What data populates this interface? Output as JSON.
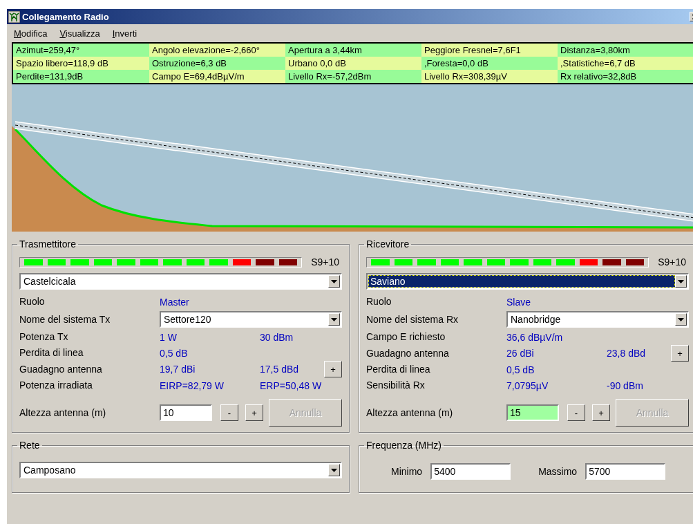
{
  "window": {
    "title": "Collegamento Radio"
  },
  "menu": [
    "Modifica",
    "Visualizza",
    "Inverti"
  ],
  "info_table": [
    [
      "Azimut=259,47°",
      "Angolo elevazione=-2,660°",
      "Apertura a 3,44km",
      "Peggiore Fresnel=7,6F1",
      "Distanza=3,80km"
    ],
    [
      "Spazio libero=118,9 dB",
      "Ostruzione=6,3 dB",
      "Urbano 0,0 dB",
      ",Foresta=0,0 dB",
      ",Statistiche=6,7 dB"
    ],
    [
      "Perdite=131,9dB",
      "Campo E=69,4dBµV/m",
      "Livello Rx=-57,2dBm",
      "Livello Rx=308,39µV",
      "Rx relativo=32,8dB"
    ]
  ],
  "stations": [
    {
      "title": "Trasmettitore",
      "meter": {
        "reading": "S9+10",
        "segments": [
          {
            "color": "#00ff00"
          },
          {
            "color": "#00ff00"
          },
          {
            "color": "#00ff00"
          },
          {
            "color": "#00ff00"
          },
          {
            "color": "#00ff00"
          },
          {
            "color": "#00ff00"
          },
          {
            "color": "#00ff00"
          },
          {
            "color": "#00ff00"
          },
          {
            "color": "#00ff00"
          },
          {
            "color": "#ff0000"
          },
          {
            "color": "#800000"
          },
          {
            "color": "#800000"
          }
        ]
      },
      "site": {
        "value": "Castelcicala",
        "selected": false
      },
      "rows": [
        {
          "kind": "values",
          "label": "Ruolo",
          "values": [
            "Master"
          ]
        },
        {
          "kind": "select",
          "label": "Nome del sistema Tx",
          "value": "Settore120"
        },
        {
          "kind": "values",
          "label": "Potenza Tx",
          "values": [
            "1 W",
            "30 dBm"
          ]
        },
        {
          "kind": "values",
          "label": "Perdita di linea",
          "values": [
            "0,5 dB"
          ]
        },
        {
          "kind": "values",
          "label": "Guadagno antenna",
          "values": [
            "19,7 dBi",
            "17,5 dBd"
          ],
          "button": "+"
        },
        {
          "kind": "values",
          "label": "Potenza irradiata",
          "values": [
            "EIRP=82,79 W",
            "ERP=50,48 W"
          ]
        }
      ],
      "height": {
        "label": "Altezza antenna (m)",
        "value": "10",
        "highlighted": false,
        "minus": "-",
        "plus": "+",
        "cancel": "Annulla",
        "cancel_disabled": true
      }
    },
    {
      "title": "Ricevitore",
      "meter": {
        "reading": "S9+10",
        "segments": [
          {
            "color": "#00ff00"
          },
          {
            "color": "#00ff00"
          },
          {
            "color": "#00ff00"
          },
          {
            "color": "#00ff00"
          },
          {
            "color": "#00ff00"
          },
          {
            "color": "#00ff00"
          },
          {
            "color": "#00ff00"
          },
          {
            "color": "#00ff00"
          },
          {
            "color": "#00ff00"
          },
          {
            "color": "#ff0000"
          },
          {
            "color": "#800000"
          },
          {
            "color": "#800000"
          }
        ]
      },
      "site": {
        "value": "Saviano",
        "selected": true
      },
      "rows": [
        {
          "kind": "values",
          "label": "Ruolo",
          "values": [
            "Slave"
          ]
        },
        {
          "kind": "select",
          "label": "Nome del sistema Rx",
          "value": "Nanobridge"
        },
        {
          "kind": "values",
          "label": "Campo E richiesto",
          "values": [
            "36,6 dBµV/m"
          ]
        },
        {
          "kind": "values",
          "label": "Guadagno antenna",
          "values": [
            "26 dBi",
            "23,8 dBd"
          ],
          "button": "+"
        },
        {
          "kind": "values",
          "label": "Perdita di linea",
          "values": [
            "0,5 dB"
          ]
        },
        {
          "kind": "values",
          "label": "Sensibilità Rx",
          "values": [
            "7,0795µV",
            "-90 dBm"
          ]
        }
      ],
      "height": {
        "label": "Altezza antenna (m)",
        "value": "15",
        "highlighted": true,
        "minus": "-",
        "plus": "+",
        "cancel": "Annulla",
        "cancel_disabled": true
      }
    }
  ],
  "network": {
    "title": "Rete",
    "value": "Camposano"
  },
  "frequency": {
    "title": "Frequenza (MHz)",
    "min_label": "Minimo",
    "min": "5400",
    "max_label": "Massimo",
    "max": "5700"
  }
}
